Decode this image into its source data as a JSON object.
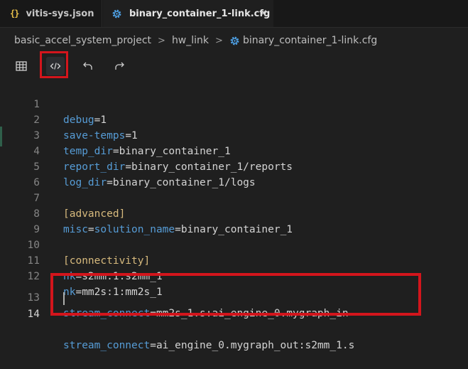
{
  "tabs": [
    {
      "label": "vitis-sys.json",
      "icon": "json-braces-icon"
    },
    {
      "label": "binary_container_1-link.cfg",
      "icon": "gear-icon",
      "close": "×",
      "active": true
    }
  ],
  "json_icon_glyph": "{}",
  "breadcrumb": {
    "items": [
      "basic_accel_system_project",
      "hw_link",
      "binary_container_1-link.cfg"
    ],
    "separator": ">"
  },
  "toolbar": {
    "buttons": [
      "table-view-icon",
      "code-view-icon",
      "undo-icon",
      "redo-icon"
    ]
  },
  "colors": {
    "key": "#569cd6",
    "section": "#d7ba7d",
    "value": "#d4d4d4",
    "highlight": "#d3151c"
  },
  "editor": {
    "lines": [
      {
        "num": "1",
        "key": "debug",
        "eq": "=",
        "val": "1"
      },
      {
        "num": "2",
        "key": "save-temps",
        "eq": "=",
        "val": "1"
      },
      {
        "num": "3",
        "key": "temp_dir",
        "eq": "=",
        "val": "binary_container_1"
      },
      {
        "num": "4",
        "key": "report_dir",
        "eq": "=",
        "val": "binary_container_1/reports"
      },
      {
        "num": "5",
        "key": "log_dir",
        "eq": "=",
        "val": "binary_container_1/logs"
      },
      {
        "num": "6"
      },
      {
        "num": "7",
        "section": "[advanced]"
      },
      {
        "num": "8",
        "key": "misc",
        "eq": "=",
        "key2": "solution_name",
        "eq2": "=",
        "val": "binary_container_1"
      },
      {
        "num": "9"
      },
      {
        "num": "10",
        "section": "[connectivity]"
      },
      {
        "num": "11",
        "key": "nk",
        "eq": "=",
        "val": "s2mm:1:s2mm_1"
      },
      {
        "num": "12",
        "key": "nk",
        "eq": "=",
        "val": "mm2s:1:mm2s_1"
      },
      {
        "num": "13",
        "key": "stream_connect",
        "eq": "=",
        "val": "mm2s_1.s:ai_engine_0.mygraph_in"
      },
      {
        "num": "14",
        "key": "stream_connect",
        "eq": "=",
        "val": "ai_engine_0.mygraph_out:s2mm_1.s"
      }
    ]
  }
}
